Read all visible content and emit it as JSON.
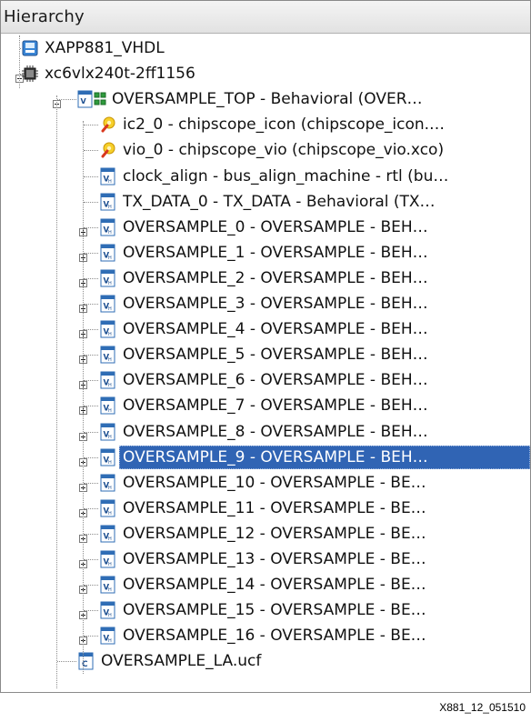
{
  "panel": {
    "title": "Hierarchy"
  },
  "tree": [
    {
      "label": "XAPP881_VHDL",
      "level": 0,
      "icon": "project-icon",
      "toggle": "none",
      "selected": false
    },
    {
      "label": "xc6vlx240t-2ff1156",
      "level": 0,
      "icon": "fpga-chip-icon",
      "toggle": "minus",
      "selected": false
    },
    {
      "label": "OVERSAMPLE_TOP - Behavioral (OVER…",
      "level": 1,
      "icon": "vhdl-top-module-icon",
      "toggle": "minus",
      "selected": false
    },
    {
      "label": "ic2_0 - chipscope_icon (chipscope_icon.…",
      "level": 2,
      "icon": "core-generator-icon",
      "toggle": "none",
      "selected": false
    },
    {
      "label": "vio_0 - chipscope_vio (chipscope_vio.xco)",
      "level": 2,
      "icon": "core-generator-icon",
      "toggle": "none",
      "selected": false
    },
    {
      "label": "clock_align - bus_align_machine - rtl (bu…",
      "level": 2,
      "icon": "vhdl-module-icon",
      "toggle": "none",
      "selected": false
    },
    {
      "label": "TX_DATA_0 - TX_DATA - Behavioral (TX…",
      "level": 2,
      "icon": "vhdl-module-icon",
      "toggle": "none",
      "selected": false
    },
    {
      "label": "OVERSAMPLE_0 - OVERSAMPLE - BEH…",
      "level": 2,
      "icon": "vhdl-module-icon",
      "toggle": "plus",
      "selected": false
    },
    {
      "label": "OVERSAMPLE_1 - OVERSAMPLE - BEH…",
      "level": 2,
      "icon": "vhdl-module-icon",
      "toggle": "plus",
      "selected": false
    },
    {
      "label": "OVERSAMPLE_2 - OVERSAMPLE - BEH…",
      "level": 2,
      "icon": "vhdl-module-icon",
      "toggle": "plus",
      "selected": false
    },
    {
      "label": "OVERSAMPLE_3 - OVERSAMPLE - BEH…",
      "level": 2,
      "icon": "vhdl-module-icon",
      "toggle": "plus",
      "selected": false
    },
    {
      "label": "OVERSAMPLE_4 - OVERSAMPLE - BEH…",
      "level": 2,
      "icon": "vhdl-module-icon",
      "toggle": "plus",
      "selected": false
    },
    {
      "label": "OVERSAMPLE_5 - OVERSAMPLE - BEH…",
      "level": 2,
      "icon": "vhdl-module-icon",
      "toggle": "plus",
      "selected": false
    },
    {
      "label": "OVERSAMPLE_6 - OVERSAMPLE - BEH…",
      "level": 2,
      "icon": "vhdl-module-icon",
      "toggle": "plus",
      "selected": false
    },
    {
      "label": "OVERSAMPLE_7 - OVERSAMPLE - BEH…",
      "level": 2,
      "icon": "vhdl-module-icon",
      "toggle": "plus",
      "selected": false
    },
    {
      "label": "OVERSAMPLE_8 - OVERSAMPLE - BEH…",
      "level": 2,
      "icon": "vhdl-module-icon",
      "toggle": "plus",
      "selected": false
    },
    {
      "label": "OVERSAMPLE_9 - OVERSAMPLE - BEH…",
      "level": 2,
      "icon": "vhdl-module-icon",
      "toggle": "plus",
      "selected": true
    },
    {
      "label": "OVERSAMPLE_10 - OVERSAMPLE - BE…",
      "level": 2,
      "icon": "vhdl-module-icon",
      "toggle": "plus",
      "selected": false
    },
    {
      "label": "OVERSAMPLE_11 - OVERSAMPLE - BE…",
      "level": 2,
      "icon": "vhdl-module-icon",
      "toggle": "plus",
      "selected": false
    },
    {
      "label": "OVERSAMPLE_12 - OVERSAMPLE - BE…",
      "level": 2,
      "icon": "vhdl-module-icon",
      "toggle": "plus",
      "selected": false
    },
    {
      "label": "OVERSAMPLE_13 - OVERSAMPLE - BE…",
      "level": 2,
      "icon": "vhdl-module-icon",
      "toggle": "plus",
      "selected": false
    },
    {
      "label": "OVERSAMPLE_14 - OVERSAMPLE - BE…",
      "level": 2,
      "icon": "vhdl-module-icon",
      "toggle": "plus",
      "selected": false
    },
    {
      "label": "OVERSAMPLE_15 - OVERSAMPLE - BE…",
      "level": 2,
      "icon": "vhdl-module-icon",
      "toggle": "plus",
      "selected": false
    },
    {
      "label": "OVERSAMPLE_16 - OVERSAMPLE - BE…",
      "level": 2,
      "icon": "vhdl-module-icon",
      "toggle": "plus",
      "selected": false
    },
    {
      "label": "OVERSAMPLE_LA.ucf",
      "level": 1,
      "icon": "ucf-constraints-icon",
      "toggle": "none",
      "selected": false
    }
  ],
  "colors": {
    "selection": "#3064b4",
    "selection_text": "#ffffff",
    "text": "#111111"
  },
  "figure_id": "X881_12_051510"
}
